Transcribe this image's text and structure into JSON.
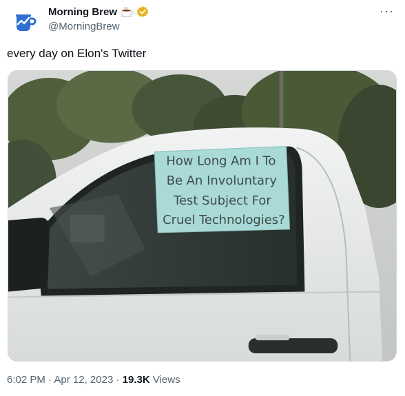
{
  "author": {
    "display_name": "Morning Brew",
    "handle": "@MorningBrew",
    "avatar_icon": "morning-brew-mug-logo",
    "badge_icons": [
      "coffee-cup-emoji",
      "verified-gold-badge"
    ]
  },
  "menu": {
    "icon": "more-horizontal-icon",
    "glyph": "···"
  },
  "tweet": {
    "text": "every day on Elon's Twitter"
  },
  "media": {
    "sign_lines": [
      "How Long Am I To",
      "Be An Involuntary",
      "Test Subject For",
      "Cruel Technologies?"
    ]
  },
  "meta": {
    "time": "6:02 PM",
    "sep1": " · ",
    "date": "Apr 12, 2023",
    "sep2": " · ",
    "views_count": "19.3K",
    "views_label": " Views"
  },
  "colors": {
    "text": "#0f1419",
    "muted": "#536471",
    "brand_blue": "#2f6fd1",
    "badge_gold": "#e8b322"
  }
}
